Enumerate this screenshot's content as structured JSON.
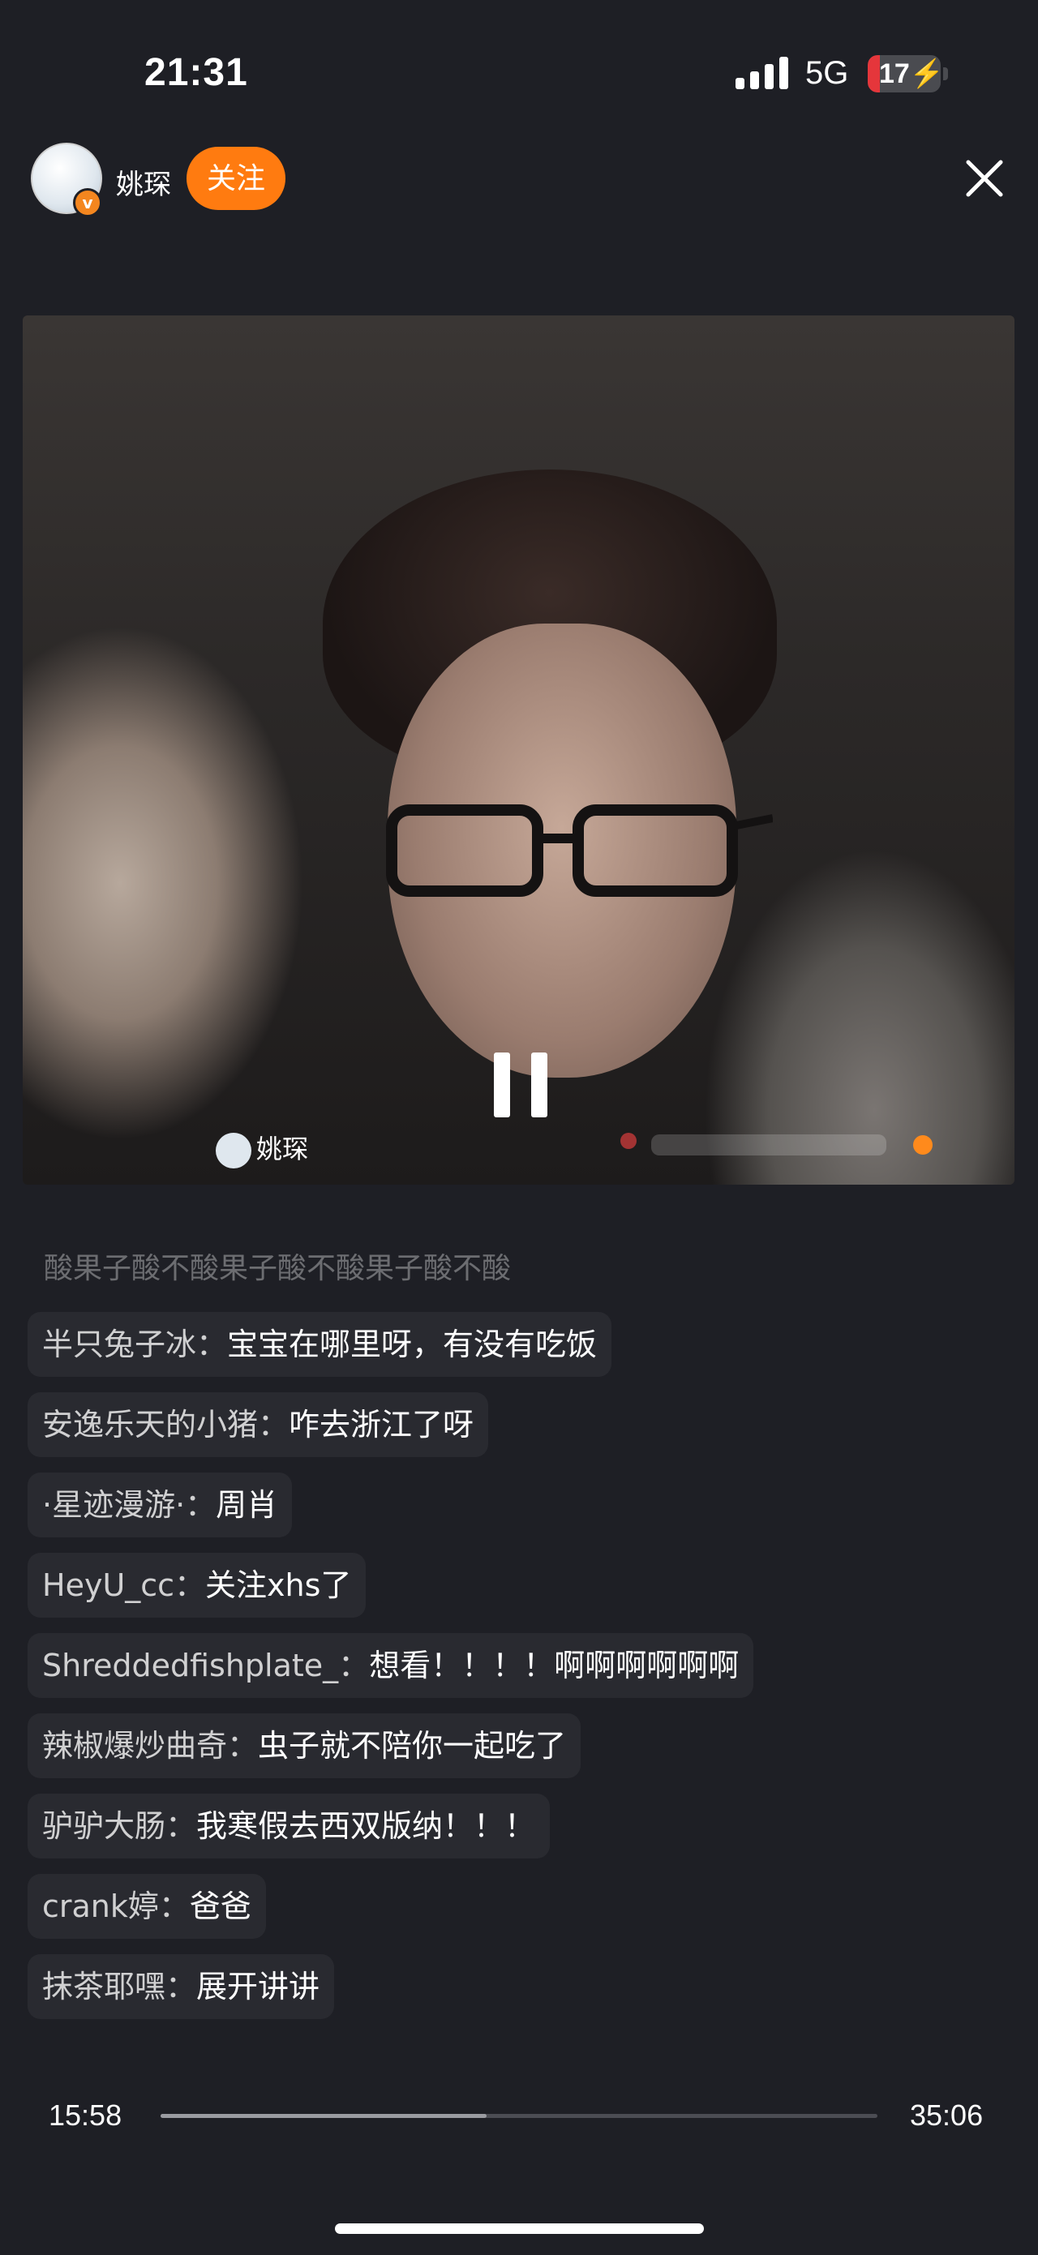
{
  "status_bar": {
    "time": "21:31",
    "network": "5G",
    "battery": "17",
    "battery_level": 0.17
  },
  "header": {
    "username": "姚琛",
    "avatar_badge": "v",
    "follow_label": "关注"
  },
  "video": {
    "watermark_user": "姚琛",
    "state": "playing",
    "accent": "#ff7b10"
  },
  "comments": {
    "faded_top": "酸果子酸不酸果子酸不酸果子酸不酸",
    "items": [
      {
        "name": "半只兔子冰：",
        "text": "宝宝在哪里呀，有没有吃饭"
      },
      {
        "name": "安逸乐天的小猪：",
        "text": "咋去浙江了呀"
      },
      {
        "name": "·星迹漫游·：",
        "text": "周肖"
      },
      {
        "name": "HeyU_cc：",
        "text": "关注xhs了"
      },
      {
        "name": "Shreddedfishplate_：",
        "text": "想看！！！！啊啊啊啊啊啊"
      },
      {
        "name": "辣椒爆炒曲奇：",
        "text": "虫子就不陪你一起吃了"
      },
      {
        "name": "驴驴大肠：",
        "text": "我寒假去西双版纳！！！"
      },
      {
        "name": "crank婷：",
        "text": "爸爸"
      },
      {
        "name": "抹茶耶嘿：",
        "text": "展开讲讲"
      }
    ]
  },
  "progress": {
    "current": "15:58",
    "total": "35:06",
    "fraction": 0.455
  }
}
